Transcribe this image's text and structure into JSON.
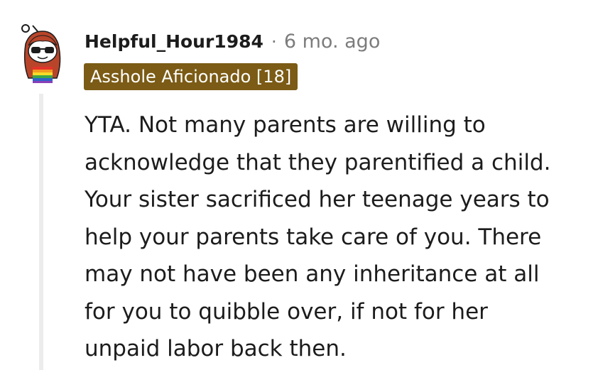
{
  "comment": {
    "avatar_icon": "snoo-avatar-icon",
    "username": "Helpful_Hour1984",
    "separator": "·",
    "timestamp": "6 mo. ago",
    "flair": "Asshole Aficionado [18]",
    "flair_color": "#7b5b15",
    "body_lines": [
      "YTA. Not many parents are willing to",
      "acknowledge that they parentified a child.",
      "Your sister sacrificed her teenage years to",
      "help your parents take care of you. There",
      "may not have been any inheritance at all",
      "for you to quibble over, if not for her",
      "unpaid labor back then."
    ]
  }
}
